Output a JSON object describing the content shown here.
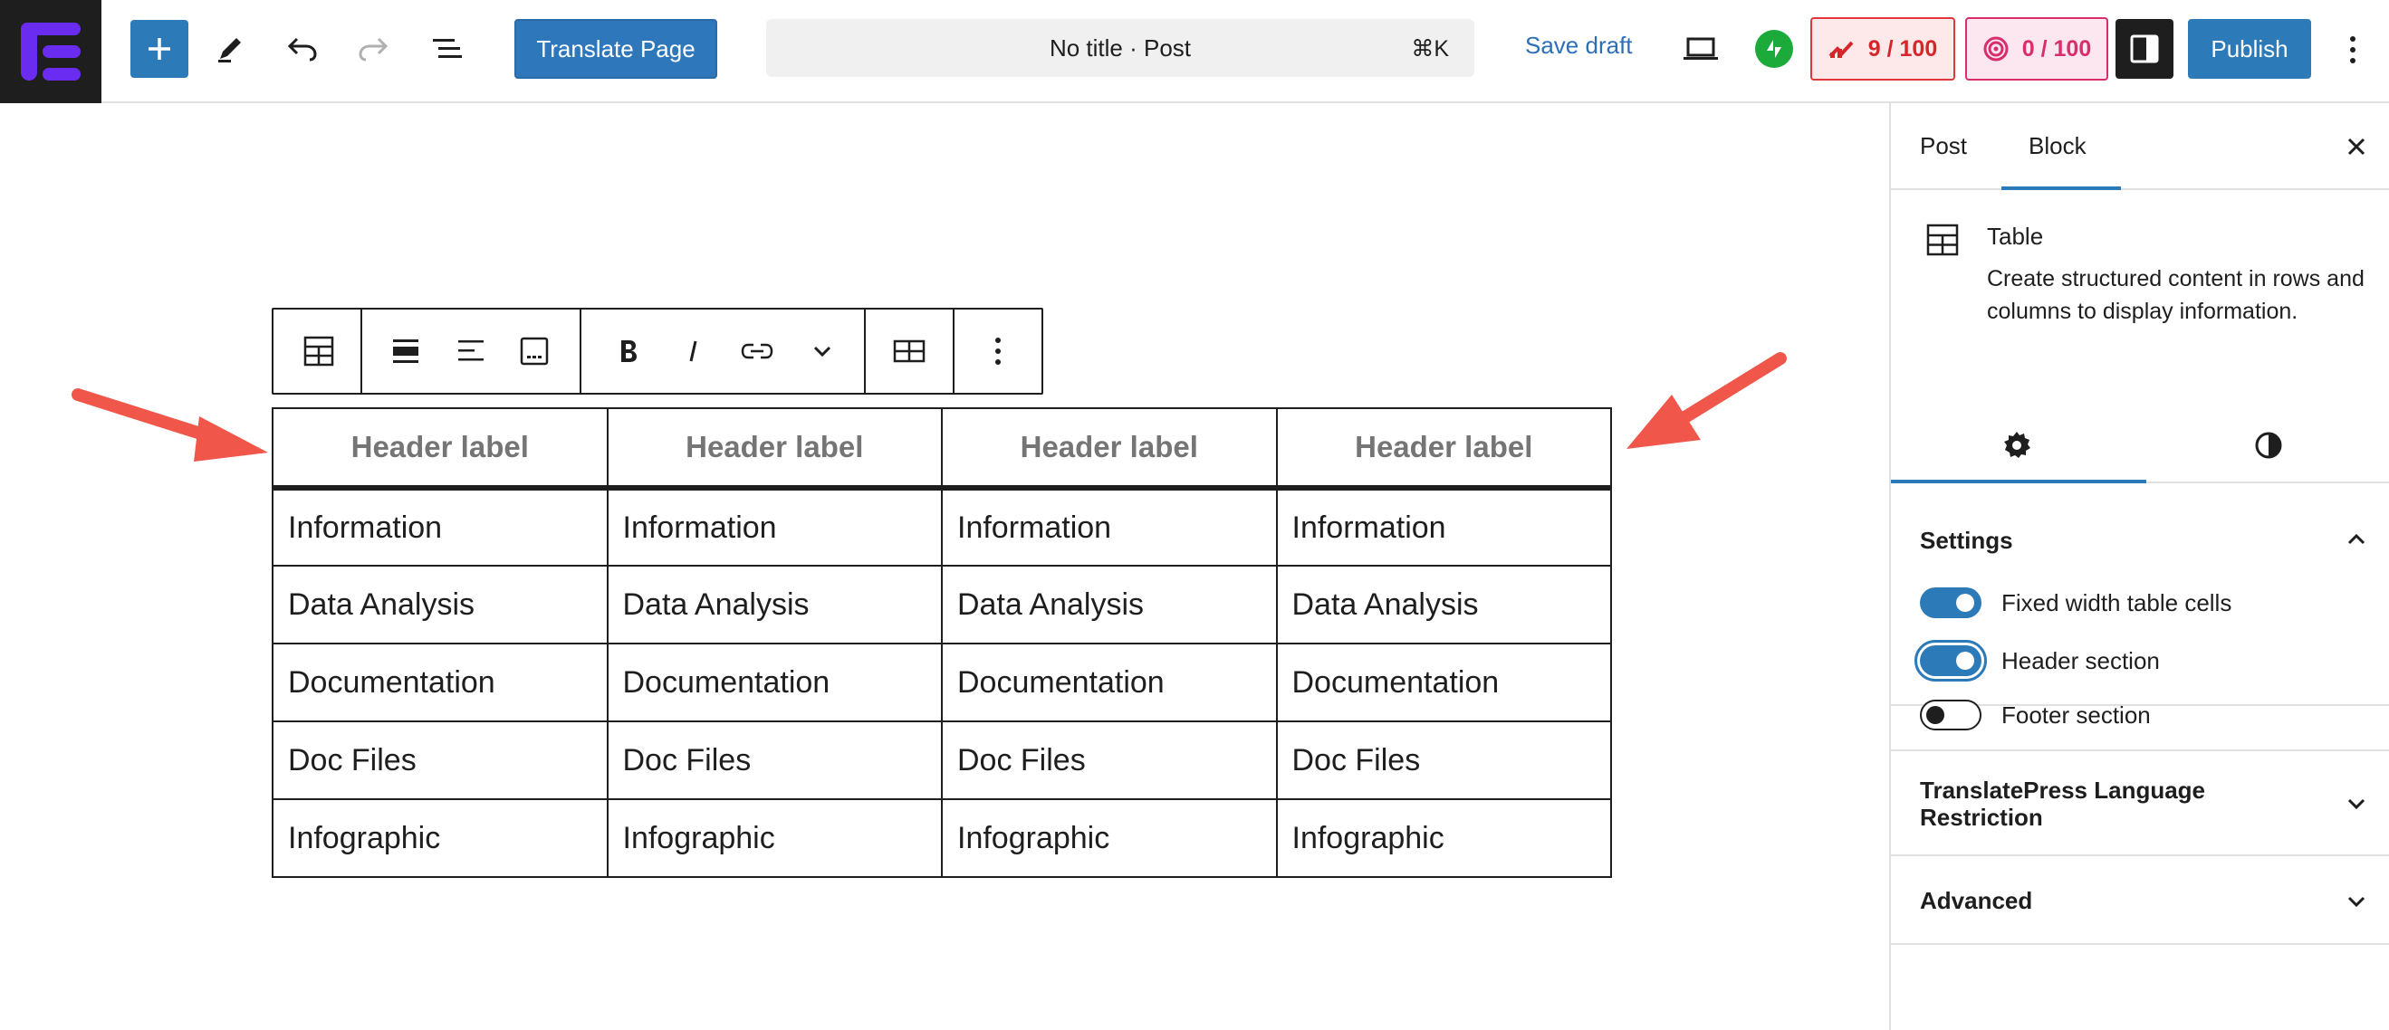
{
  "topbar": {
    "translate_label": "Translate Page",
    "command_title": "No title · Post",
    "command_shortcut": "⌘K",
    "save_draft_label": "Save draft",
    "seo_score": "9 / 100",
    "readability_score": "0 / 100",
    "publish_label": "Publish"
  },
  "table": {
    "headers": [
      "Header label",
      "Header label",
      "Header label",
      "Header label"
    ],
    "rows": [
      [
        "Information",
        "Information",
        "Information",
        "Information"
      ],
      [
        "Data Analysis",
        "Data Analysis",
        "Data Analysis",
        "Data Analysis"
      ],
      [
        "Documentation",
        "Documentation",
        "Documentation",
        "Documentation"
      ],
      [
        "Doc Files",
        "Doc Files",
        "Doc Files",
        "Doc Files"
      ],
      [
        "Infographic",
        "Infographic",
        "Infographic",
        "Infographic"
      ]
    ]
  },
  "sidebar": {
    "tabs": {
      "post": "Post",
      "block": "Block"
    },
    "block_card": {
      "title": "Table",
      "description": "Create structured content in rows and columns to display information."
    },
    "settings": {
      "title": "Settings",
      "toggles": {
        "fixed_width": {
          "label": "Fixed width table cells",
          "on": true
        },
        "header": {
          "label": "Header section",
          "on": true
        },
        "footer": {
          "label": "Footer section",
          "on": false
        }
      }
    },
    "translatepress_title": "TranslatePress Language Restriction",
    "advanced_title": "Advanced"
  },
  "colors": {
    "accent": "#2c7ab8",
    "arrow": "#f0574a",
    "seo_bad": "#d7262b",
    "readability_bad": "#d92e6b"
  }
}
